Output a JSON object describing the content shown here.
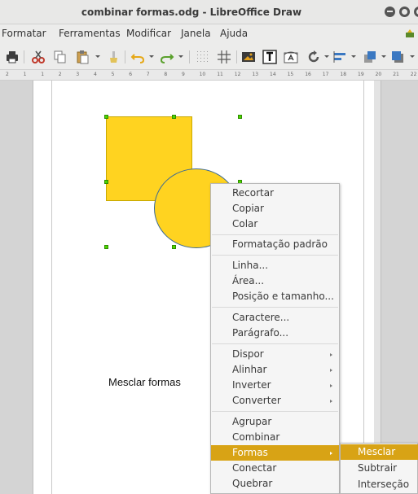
{
  "window": {
    "title": "combinar formas.odg - LibreOffice Draw"
  },
  "menubar": {
    "items": [
      "Formatar",
      "Ferramentas",
      "Modificar",
      "Janela",
      "Ajuda"
    ]
  },
  "ruler": {
    "labels": [
      "2",
      "1",
      "1",
      "2",
      "3",
      "4",
      "5",
      "6",
      "7",
      "8",
      "9",
      "10",
      "11",
      "12",
      "13",
      "14",
      "15",
      "16",
      "17",
      "18",
      "19",
      "20",
      "21",
      "22"
    ]
  },
  "canvas": {
    "caption": "Mesclar formas",
    "colors": {
      "fill": "#ffd320",
      "handle": "#4cd600",
      "circle_border": "#3d6b94"
    }
  },
  "context_menu": {
    "items": [
      "Recortar",
      "Copiar",
      "Colar",
      "Formatação padrão",
      "Linha...",
      "Área...",
      "Posição e tamanho...",
      "Caractere...",
      "Parágrafo...",
      "Dispor",
      "Alinhar",
      "Inverter",
      "Converter",
      "Agrupar",
      "Combinar",
      "Formas",
      "Conectar",
      "Quebrar"
    ],
    "highlighted": "Formas",
    "highlight_color": "#d8a315"
  },
  "submenu_formas": {
    "items": [
      "Mesclar",
      "Subtrair",
      "Interseção"
    ],
    "highlighted": "Mesclar"
  }
}
